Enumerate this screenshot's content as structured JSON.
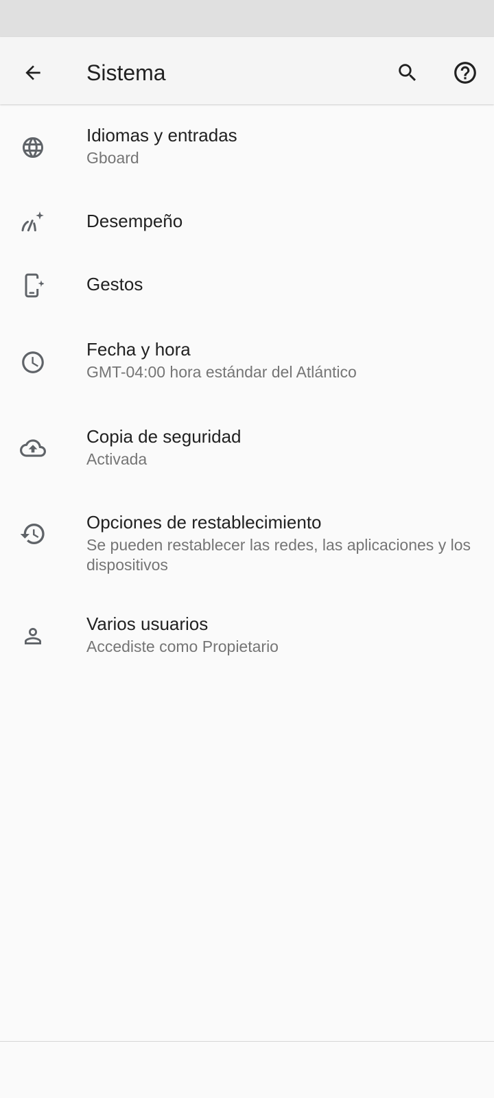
{
  "app_bar": {
    "title": "Sistema",
    "back_icon": "arrow-back-icon",
    "search_icon": "search-icon",
    "help_icon": "help-icon"
  },
  "items": [
    {
      "label": "Idiomas y entradas",
      "summary": "Gboard",
      "icon": "globe-icon"
    },
    {
      "label": "Desempeño",
      "summary": "",
      "icon": "performance-icon"
    },
    {
      "label": "Gestos",
      "summary": "",
      "icon": "gestures-icon"
    },
    {
      "label": "Fecha y hora",
      "summary": "GMT-04:00 hora estándar del Atlántico",
      "icon": "clock-icon"
    },
    {
      "label": "Copia de seguridad",
      "summary": "Activada",
      "icon": "cloud-upload-icon"
    },
    {
      "label": "Opciones de restablecimiento",
      "summary": "Se pueden restablecer las redes, las aplicaciones y los dispositivos",
      "icon": "history-icon"
    },
    {
      "label": "Varios usuarios",
      "summary": "Accediste como Propietario",
      "icon": "person-icon"
    }
  ],
  "colors": {
    "status_bar": "#e0e0e0",
    "app_bar": "#f5f5f5",
    "background": "#fafafa",
    "primary_text": "#212121",
    "secondary_text": "#757575",
    "icon": "#5f6368"
  }
}
